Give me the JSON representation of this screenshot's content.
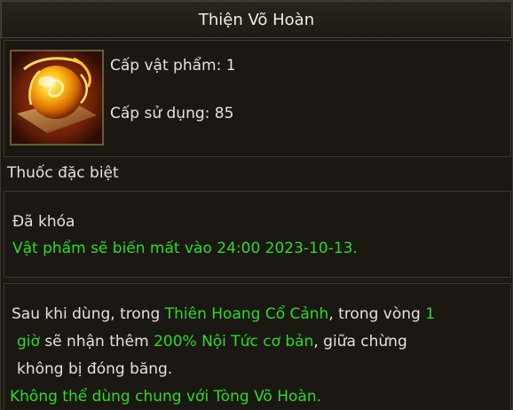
{
  "item": {
    "name": "Thiện Võ Hoàn",
    "icon": "golden-orb-pill-icon",
    "item_level": "Cấp vật phẩm: 1",
    "use_level": "Cấp sử dụng: 85",
    "category": "Thuốc đặc biệt"
  },
  "lock_info": {
    "status": "Đã khóa",
    "expiry": "Vật phẩm sẽ biến mất vào 24:00 2023-10-13."
  },
  "description": {
    "line1": [
      {
        "text": "Sau khi dùng, trong ",
        "color": "white"
      },
      {
        "text": "Thiên Hoang Cổ Cảnh",
        "color": "green"
      },
      {
        "text": ", trong vòng ",
        "color": "white"
      },
      {
        "text": "1",
        "color": "green"
      }
    ],
    "line2": [
      {
        "text": "giờ",
        "color": "green"
      },
      {
        "text": " sẽ nhận thêm ",
        "color": "white"
      },
      {
        "text": "200% Nội Tức cơ bản",
        "color": "green"
      },
      {
        "text": ", giữa chừng",
        "color": "white"
      }
    ],
    "line3": "không bị đóng băng.",
    "line4": "Không thể dùng chung với Tòng Võ Hoàn."
  },
  "colors": {
    "text_white": "#e6e2da",
    "text_green": "#2bdc25",
    "background": "#1b1713",
    "border": "#3e372d"
  }
}
